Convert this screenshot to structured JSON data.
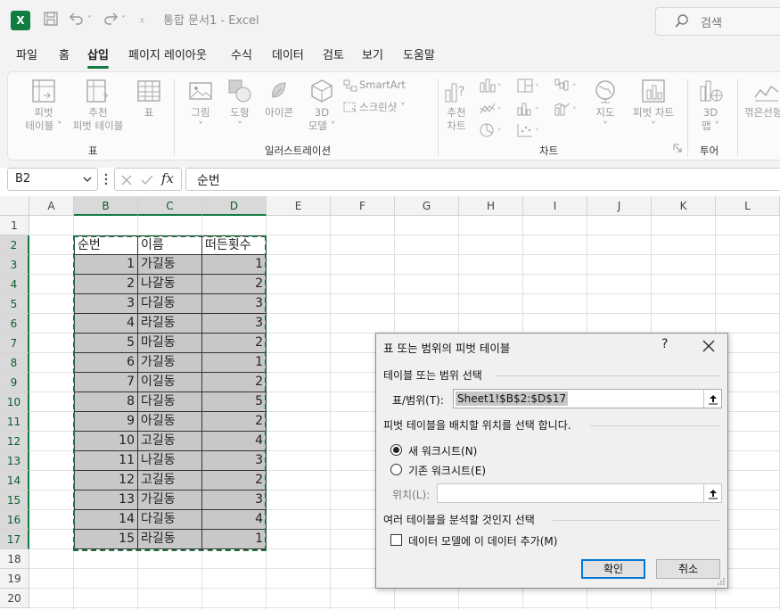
{
  "app": {
    "title": "통합 문서1  -  Excel",
    "search_placeholder": "검색",
    "accent": "#107c41"
  },
  "menu_tabs": [
    "파일",
    "홈",
    "삽입",
    "페이지 레이아웃",
    "수식",
    "데이터",
    "검토",
    "보기",
    "도움말"
  ],
  "active_tab": "삽입",
  "ribbon": {
    "pivot_table": [
      "피벗",
      "테이블 ˅"
    ],
    "recommended_pivot": [
      "추천",
      "피벗 테이블"
    ],
    "table": "표",
    "group_table": "표",
    "picture": "그림",
    "shapes": "도형",
    "icons": "아이콘",
    "models_3d": [
      "3D",
      "모델 ˅"
    ],
    "smartart": "SmartArt",
    "screenshot": "스크린샷 ˅",
    "group_illustrations": "일러스트레이션",
    "recommended_charts": [
      "추천",
      "차트"
    ],
    "maps": "지도",
    "pivot_chart": "피벗 차트",
    "group_charts": "차트",
    "map_3d": [
      "3D",
      "맵 ˅"
    ],
    "group_tours": "투어",
    "sparkline_line": "꺾은선형"
  },
  "formula_bar": {
    "name_box": "B2",
    "fx": "fx",
    "content": "순번"
  },
  "sheet": {
    "columns": [
      "A",
      "B",
      "C",
      "D",
      "E",
      "F",
      "G",
      "H",
      "I",
      "J",
      "K",
      "L"
    ],
    "rows": [
      "1",
      "2",
      "3",
      "4",
      "5",
      "6",
      "7",
      "8",
      "9",
      "10",
      "11",
      "12",
      "13",
      "14",
      "15",
      "16",
      "17",
      "18",
      "19",
      "20"
    ],
    "headers": [
      "순번",
      "이름",
      "떠든횟수"
    ],
    "data": [
      [
        1,
        "가길동",
        1
      ],
      [
        2,
        "나갈동",
        2
      ],
      [
        3,
        "다길동",
        3
      ],
      [
        4,
        "라길동",
        3
      ],
      [
        5,
        "마길동",
        2
      ],
      [
        6,
        "가길동",
        1
      ],
      [
        7,
        "이길동",
        2
      ],
      [
        8,
        "다길동",
        5
      ],
      [
        9,
        "아길동",
        2
      ],
      [
        10,
        "고길동",
        4
      ],
      [
        11,
        "나길동",
        3
      ],
      [
        12,
        "고길동",
        2
      ],
      [
        13,
        "가길동",
        3
      ],
      [
        14,
        "다길동",
        4
      ],
      [
        15,
        "라길동",
        1
      ]
    ]
  },
  "dialog": {
    "title": "표 또는 범위의 피벗 테이블",
    "help": "?",
    "section_select": "테이블 또는 범위 선택",
    "range_label": "표/범위(T):",
    "range_value": "Sheet1!$B$2:$D$17",
    "section_place": "피벗 테이블을 배치할 위치를 선택 합니다.",
    "opt_new": "새 워크시트(N)",
    "opt_existing": "기존 워크시트(E)",
    "location_label": "위치(L):",
    "location_value": "",
    "section_multi": "여러 테이블을 분석할 것인지 선택",
    "add_model": "데이터 모델에 이 데이터 추가(M)",
    "ok": "확인",
    "cancel": "취소"
  }
}
